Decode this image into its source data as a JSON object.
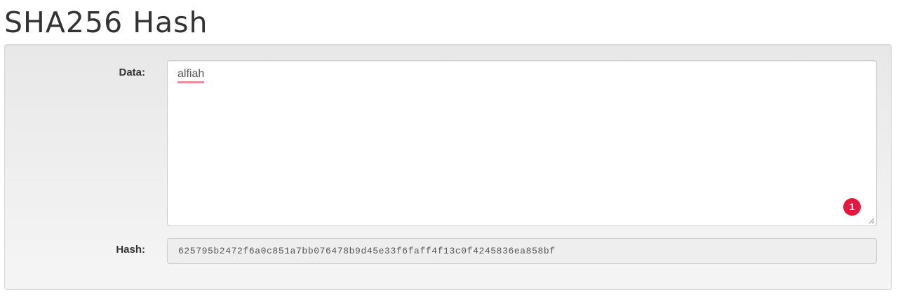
{
  "page": {
    "title": "SHA256 Hash"
  },
  "form": {
    "data_label": "Data:",
    "data_value": "alfiah",
    "hash_label": "Hash:",
    "hash_value": "625795b2472f6a0c851a7bb076478b9d45e33f6faff4f13c0f4245836ea858bf"
  },
  "badge": {
    "count": "1",
    "color": "#e8163f"
  },
  "icons": {
    "resize": "resize-handle-icon"
  }
}
